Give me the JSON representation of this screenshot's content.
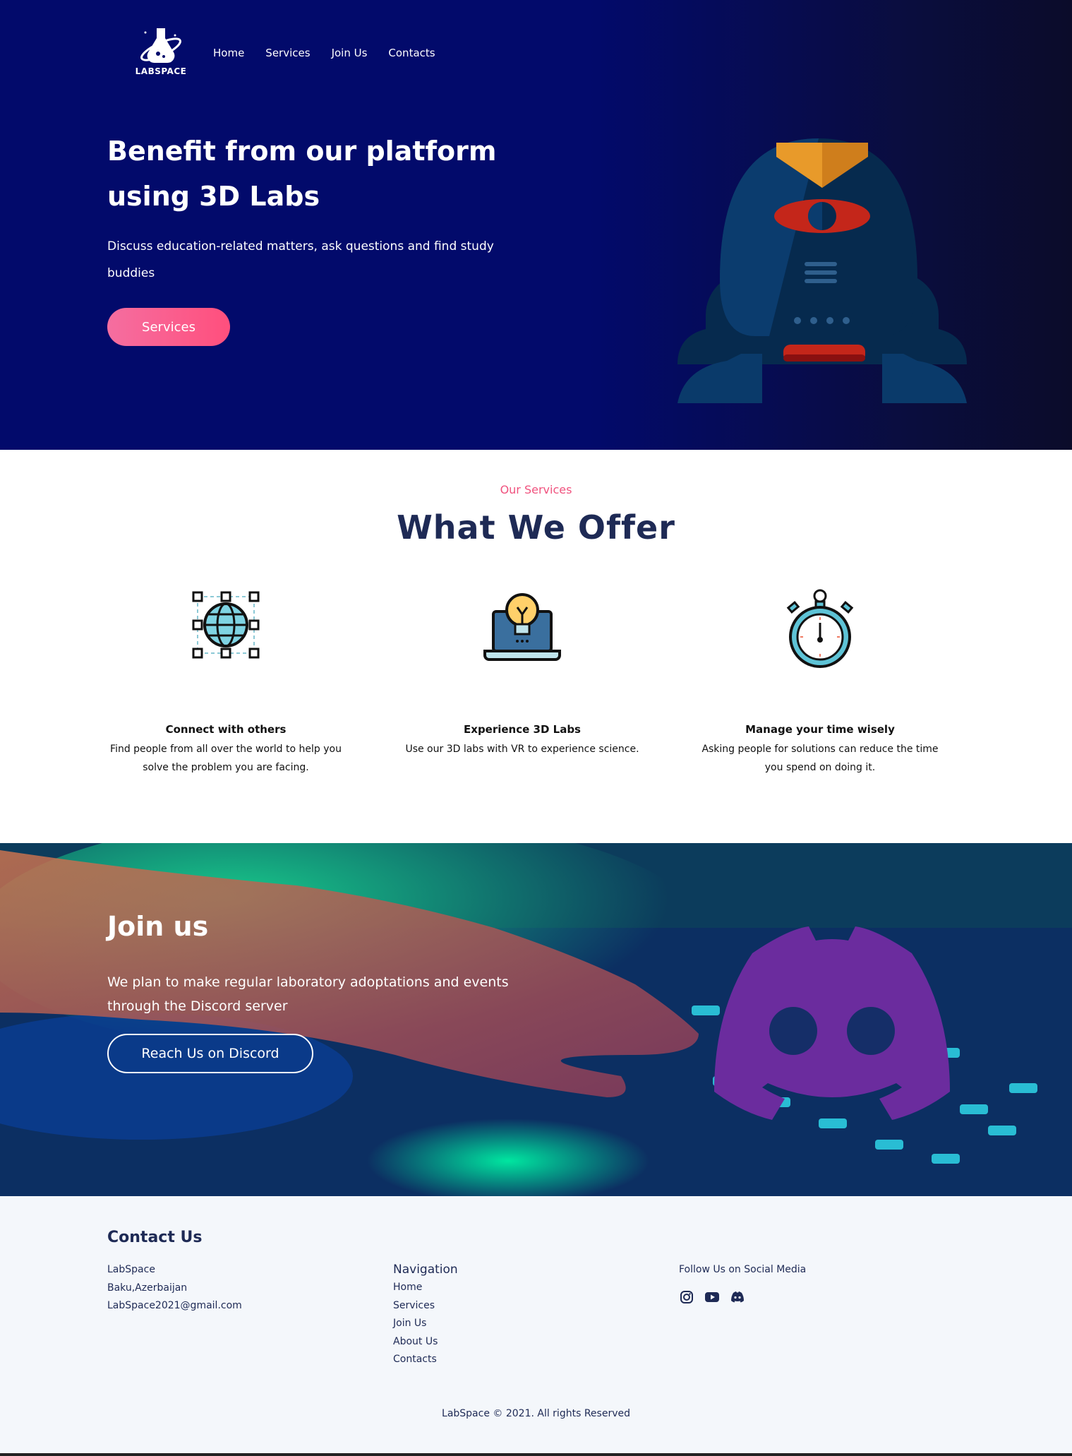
{
  "brand": {
    "name": "LABSPACE",
    "logo_icon": "flask-planet-icon"
  },
  "nav": {
    "items": [
      "Home",
      "Services",
      "Join Us",
      "Contacts"
    ]
  },
  "hero": {
    "title": "Benefit from our platform using 3D Labs",
    "subtitle": "Discuss education-related matters, ask questions and find study buddies",
    "cta": "Services",
    "illustration": "robot-vr-illustration"
  },
  "services": {
    "eyebrow": "Our Services",
    "title": "What We Offer",
    "items": [
      {
        "icon": "globe-network-icon",
        "title": "Connect with others",
        "desc": "Find people from all over the world to help you solve the problem you are facing."
      },
      {
        "icon": "laptop-lightbulb-icon",
        "title": "Experience 3D Labs",
        "desc": "Use our 3D labs with VR to experience science."
      },
      {
        "icon": "stopwatch-icon",
        "title": "Manage your time wisely",
        "desc": "Asking people for solutions can reduce the time you spend on doing it."
      }
    ]
  },
  "join": {
    "title": "Join us",
    "text": "We plan to make regular laboratory adoptations and events through the Discord server",
    "cta": "Reach Us on Discord",
    "logo": "discord-icon"
  },
  "footer": {
    "contact_title": "Contact Us",
    "contact": [
      "LabSpace",
      "Baku,Azerbaijan",
      "LabSpace2021@gmail.com"
    ],
    "nav_title": "Navigation",
    "nav_links": [
      "Home",
      "Services",
      "Join Us",
      "About Us",
      "Contacts"
    ],
    "social_title": "Follow Us on Social Media",
    "social_icons": [
      "instagram-icon",
      "youtube-icon",
      "discord-icon"
    ],
    "copyright": "LabSpace © 2021. All rights Reserved"
  },
  "colors": {
    "hero_bg": "#020a6b",
    "accent": "#f0527e",
    "heading": "#1e2a55",
    "discord": "#6b2c9e"
  }
}
